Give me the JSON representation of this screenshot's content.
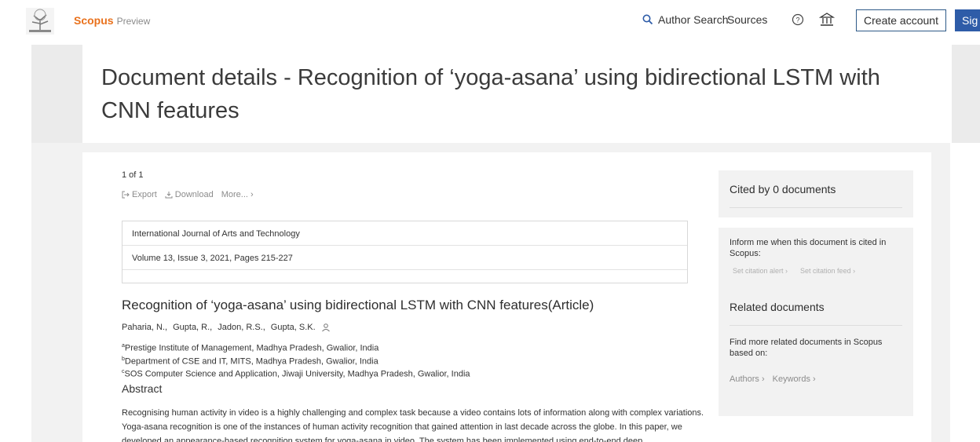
{
  "brand": {
    "name": "Scopus",
    "edition": "Preview"
  },
  "nav": {
    "author_search": "Author Search",
    "sources": "Sources",
    "create_account": "Create account",
    "sign_in": "Sig"
  },
  "page": {
    "title": "Document details - Recognition of ‘yoga-asana’ using bidirectional LSTM with CNN features"
  },
  "toolbar": {
    "pager": "1 of 1",
    "export": "Export",
    "download": "Download",
    "more": "More... ›"
  },
  "source": {
    "journal": "International Journal of Arts and Technology",
    "volume": "Volume 13, Issue 3, 2021, Pages 215-227"
  },
  "article": {
    "title": "Recognition of ‘yoga-asana’ using bidirectional LSTM with CNN features(Article)",
    "authors": [
      "Paharia, N.,",
      "Gupta, R.,",
      "Jadon, R.S.,",
      "Gupta, S.K."
    ],
    "affiliations": [
      {
        "mark": "a",
        "text": "Prestige Institute of Management, Madhya Pradesh, Gwalior, India"
      },
      {
        "mark": "b",
        "text": "Department of CSE and IT, MITS, Madhya Pradesh, Gwalior, India"
      },
      {
        "mark": "c",
        "text": "SOS Computer Science and Application, Jiwaji University, Madhya Pradesh, Gwalior, India"
      }
    ],
    "abstract_heading": "Abstract",
    "abstract_text": "Recognising human activity in video is a highly challenging and complex task because a video contains lots of information along with complex variations. Yoga-asana recognition is one of the instances of human activity recognition that gained attention in last decade across the globe. In this paper, we developed an appearance-based recognition system for yoga-asana in video. The system has been implemented using end-to-end deep"
  },
  "sidebar": {
    "cited_by": "Cited by 0 documents",
    "inform": "Inform me when this document is cited in Scopus:",
    "set_alert": "Set citation alert ›",
    "set_feed": "Set citation feed ›",
    "related": "Related documents",
    "find_more": "Find more related documents in Scopus based on:",
    "authors_link": "Authors ›",
    "keywords_link": "Keywords ›"
  },
  "colors": {
    "brand_orange": "#e9711c",
    "link_blue": "#2e5ca8"
  }
}
